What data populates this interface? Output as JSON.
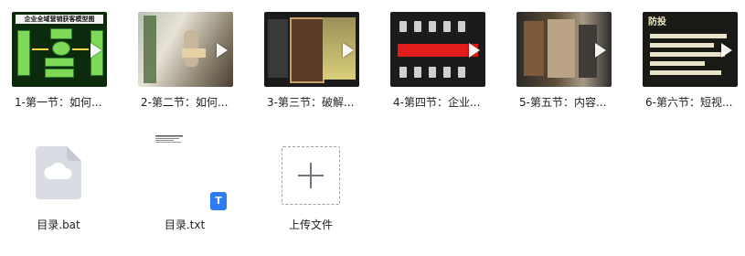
{
  "files": [
    {
      "caption": "1-第一节：如何...",
      "thumb_title": "企业全域营销获客模型图",
      "thumb_labels": [
        "企",
        "业"
      ]
    },
    {
      "caption": "2-第二节：如何..."
    },
    {
      "caption": "3-第三节：破解..."
    },
    {
      "caption": "4-第四节：企业..."
    },
    {
      "caption": "5-第五节：内容..."
    },
    {
      "caption": "6-第六节：短视...",
      "thumb_title": "防投"
    }
  ],
  "bottom_files": [
    {
      "name": "目录.bat",
      "icon": "cloud-file-icon"
    },
    {
      "name": "目录.txt",
      "icon": "txt-file-icon",
      "badge": "T"
    },
    {
      "name": "上传文件",
      "icon": "plus-icon"
    }
  ],
  "colors": {
    "accent": "#2d7cf6",
    "play": "#ffffff",
    "t4_band": "#e21b1b"
  }
}
